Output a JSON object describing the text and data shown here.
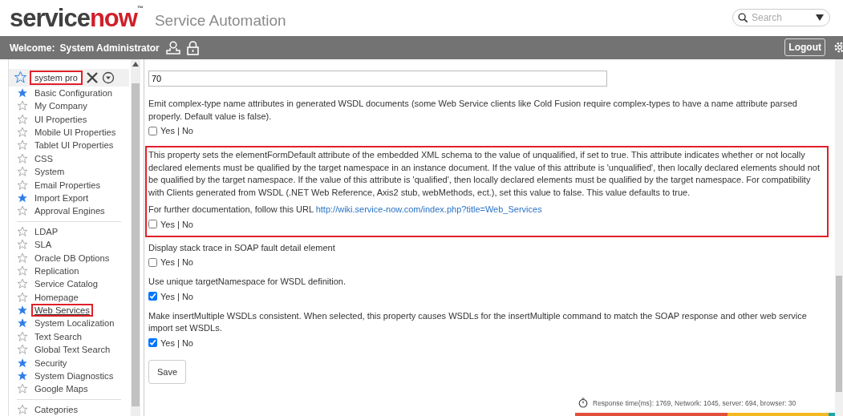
{
  "header": {
    "logo": {
      "prefix": "service",
      "accent": "now",
      "mark": "™"
    },
    "product": "Service Automation",
    "search": {
      "placeholder": "Search"
    }
  },
  "nav": {
    "welcome": "Welcome:",
    "user": "System Administrator",
    "logout": "Logout"
  },
  "sidebar": {
    "filter": {
      "value": "system pro",
      "highlighted": true
    },
    "groups": [
      [
        {
          "label": "Basic Configuration",
          "starred": true,
          "selected": false
        },
        {
          "label": "My Company",
          "starred": false,
          "selected": false
        },
        {
          "label": "UI Properties",
          "starred": false,
          "selected": false
        },
        {
          "label": "Mobile UI Properties",
          "starred": false,
          "selected": false
        },
        {
          "label": "Tablet UI Properties",
          "starred": false,
          "selected": false
        },
        {
          "label": "CSS",
          "starred": false,
          "selected": false
        },
        {
          "label": "System",
          "starred": false,
          "selected": false
        },
        {
          "label": "Email Properties",
          "starred": false,
          "selected": false
        },
        {
          "label": "Import Export",
          "starred": true,
          "selected": false
        },
        {
          "label": "Approval Engines",
          "starred": false,
          "selected": false
        }
      ],
      [
        {
          "label": "LDAP",
          "starred": false,
          "selected": false
        },
        {
          "label": "SLA",
          "starred": false,
          "selected": false
        },
        {
          "label": "Oracle DB Options",
          "starred": false,
          "selected": false
        },
        {
          "label": "Replication",
          "starred": false,
          "selected": false
        },
        {
          "label": "Service Catalog",
          "starred": false,
          "selected": false
        },
        {
          "label": "Homepage",
          "starred": false,
          "selected": false
        },
        {
          "label": "Web Services",
          "starred": true,
          "selected": true
        },
        {
          "label": "System Localization",
          "starred": true,
          "selected": false
        },
        {
          "label": "Text Search",
          "starred": false,
          "selected": false
        },
        {
          "label": "Global Text Search",
          "starred": false,
          "selected": false
        },
        {
          "label": "Security",
          "starred": true,
          "selected": false
        },
        {
          "label": "System Diagnostics",
          "starred": true,
          "selected": false
        },
        {
          "label": "Google Maps",
          "starred": false,
          "selected": false
        }
      ],
      [
        {
          "label": "Categories",
          "starred": false,
          "selected": false
        }
      ]
    ]
  },
  "properties": [
    {
      "kind": "text",
      "value": "70"
    },
    {
      "kind": "checkbox",
      "description": "Emit complex-type name attributes in generated WSDL documents (some Web Service clients like Cold Fusion require complex-types to have a name attribute parsed properly. Default value is false).",
      "option": "Yes | No",
      "checked": false,
      "highlighted": false
    },
    {
      "kind": "checkbox",
      "description": "This property sets the elementFormDefault attribute of the embedded XML schema to the value of unqualified, if set to true. This attribute indicates whether or not locally declared elements must be qualified by the target namespace in an instance document. If the value of this attribute is 'unqualified', then locally declared elements should not be qualified by the target namespace. If the value of this attribute is 'qualified', then locally declared elements must be qualified by the target namespace. For compatibility with Clients generated from WSDL (.NET Web Reference, Axis2 stub, webMethods, ect.), set this value to false. This value defaults to true.",
      "note": "For further documentation, follow this URL",
      "link": "http://wiki.service-now.com/index.php?title=Web_Services",
      "option": "Yes | No",
      "checked": false,
      "highlighted": true
    },
    {
      "kind": "checkbox",
      "description": "Display stack trace in SOAP fault detail element",
      "option": "Yes | No",
      "checked": false,
      "highlighted": false
    },
    {
      "kind": "checkbox",
      "description": "Use unique targetNamespace for WSDL definition.",
      "option": "Yes | No",
      "checked": true,
      "highlighted": false
    },
    {
      "kind": "checkbox",
      "description": "Make insertMultiple WSDLs consistent. When selected, this property causes WSDLs for the insertMultiple command to match the SOAP response and other web service import set WSDLs.",
      "option": "Yes | No",
      "checked": true,
      "highlighted": false
    }
  ],
  "save": "Save",
  "footer": {
    "response": "Response time(ms): 1769, Network: 1045, server: 694, browser: 30"
  }
}
